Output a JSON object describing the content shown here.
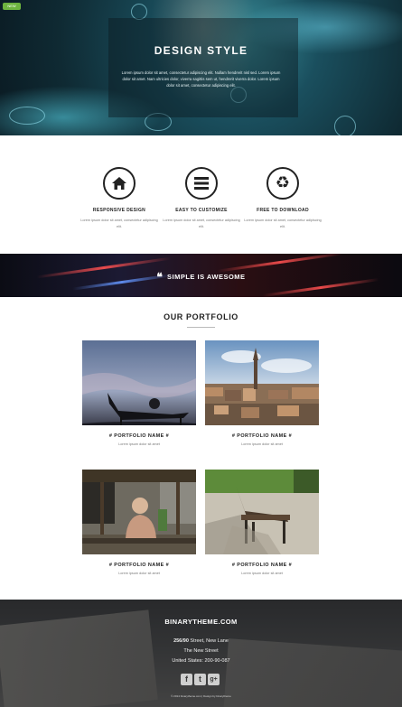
{
  "hero": {
    "badge": "NEW",
    "title": "DESIGN STYLE",
    "text": "Lorem ipsum dolor sit amet, consectetur adipiscing elit. Nullam hendrerit nisl sed. Lorem ipsum dolor sit amet. Nam ultricies dolor, viverra sagittis sem ut, hendrerit viverra dolor. Lorem ipsum dolor sit amet, consectetur adipiscing elit."
  },
  "features": [
    {
      "icon": "home-icon",
      "title": "RESPONSIVE DESIGN",
      "desc": "Lorem ipsum dolor sit amet, consectetur adipiscing elit."
    },
    {
      "icon": "menu-icon",
      "title": "EASY TO CUSTOMIZE",
      "desc": "Lorem ipsum dolor sit amet, consectetur adipiscing elit."
    },
    {
      "icon": "recycle-icon",
      "title": "FREE TO DOWNLOAD",
      "desc": "Lorem ipsum dolor sit amet, consectetur adipiscing elit."
    }
  ],
  "banner": {
    "quote_glyph": "❝",
    "text": "SIMPLE IS AWESOME"
  },
  "portfolio": {
    "title": "OUR PORTFOLIO",
    "items": [
      {
        "name": "# PORTFOLIO NAME #",
        "sub": "Lorem ipsum dolor sit amet"
      },
      {
        "name": "# PORTFOLIO NAME #",
        "sub": "Lorem ipsum dolor sit amet"
      },
      {
        "name": "# PORTFOLIO NAME #",
        "sub": "Lorem ipsum dolor sit amet"
      },
      {
        "name": "# PORTFOLIO NAME #",
        "sub": "Lorem ipsum dolor sit amet"
      }
    ]
  },
  "footer": {
    "brand": "BINARYTHEME.COM",
    "address_bold": "256/90",
    "address_rest": " Street, New Lane",
    "street": "The New Street",
    "phone": "United States: 200-90-087",
    "social": [
      "f",
      "t",
      "g+"
    ],
    "copyright": "© 2014 binarytheme.com | Design by binarytheme"
  }
}
